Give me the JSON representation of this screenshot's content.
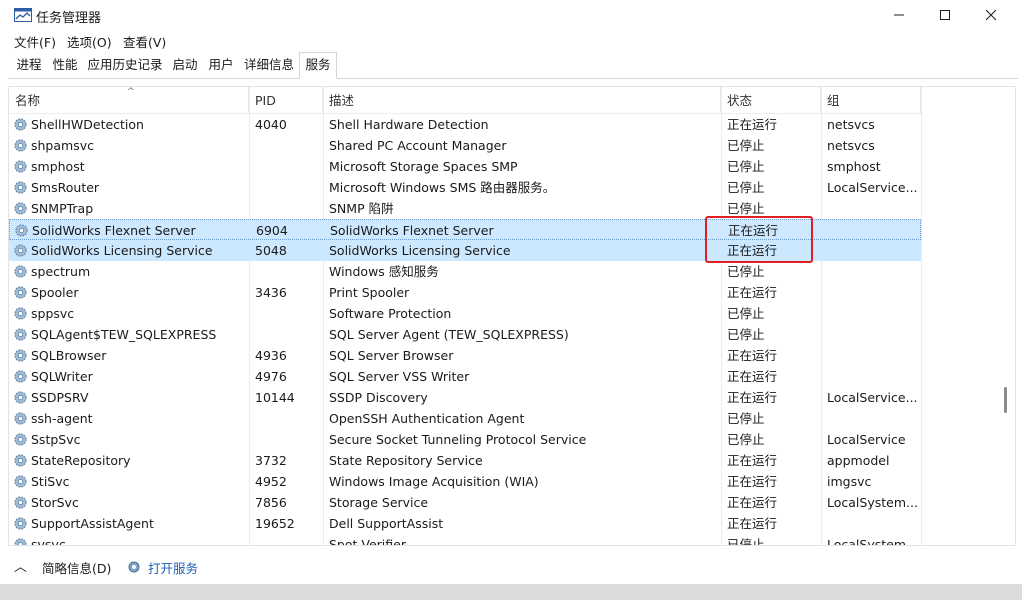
{
  "window": {
    "title": "任务管理器"
  },
  "menu": [
    "文件(F)",
    "选项(O)",
    "查看(V)"
  ],
  "tabs": [
    "进程",
    "性能",
    "应用历史记录",
    "启动",
    "用户",
    "详细信息",
    "服务"
  ],
  "active_tab": "服务",
  "columns": {
    "name": "名称",
    "pid": "PID",
    "desc": "描述",
    "status": "状态",
    "group": "组"
  },
  "rows": [
    {
      "name": "ShellHWDetection",
      "pid": "4040",
      "desc": "Shell Hardware Detection",
      "status": "正在运行",
      "group": "netsvcs"
    },
    {
      "name": "shpamsvc",
      "pid": "",
      "desc": "Shared PC Account Manager",
      "status": "已停止",
      "group": "netsvcs"
    },
    {
      "name": "smphost",
      "pid": "",
      "desc": "Microsoft Storage Spaces SMP",
      "status": "已停止",
      "group": "smphost"
    },
    {
      "name": "SmsRouter",
      "pid": "",
      "desc": "Microsoft Windows SMS 路由器服务。",
      "status": "已停止",
      "group": "LocalService..."
    },
    {
      "name": "SNMPTrap",
      "pid": "",
      "desc": "SNMP 陷阱",
      "status": "已停止",
      "group": ""
    },
    {
      "name": "SolidWorks Flexnet Server",
      "pid": "6904",
      "desc": "SolidWorks Flexnet Server",
      "status": "正在运行",
      "group": ""
    },
    {
      "name": "SolidWorks Licensing Service",
      "pid": "5048",
      "desc": "SolidWorks Licensing Service",
      "status": "正在运行",
      "group": ""
    },
    {
      "name": "spectrum",
      "pid": "",
      "desc": "Windows 感知服务",
      "status": "已停止",
      "group": ""
    },
    {
      "name": "Spooler",
      "pid": "3436",
      "desc": "Print Spooler",
      "status": "正在运行",
      "group": ""
    },
    {
      "name": "sppsvc",
      "pid": "",
      "desc": "Software Protection",
      "status": "已停止",
      "group": ""
    },
    {
      "name": "SQLAgent$TEW_SQLEXPRESS",
      "pid": "",
      "desc": "SQL Server Agent (TEW_SQLEXPRESS)",
      "status": "已停止",
      "group": ""
    },
    {
      "name": "SQLBrowser",
      "pid": "4936",
      "desc": "SQL Server Browser",
      "status": "正在运行",
      "group": ""
    },
    {
      "name": "SQLWriter",
      "pid": "4976",
      "desc": "SQL Server VSS Writer",
      "status": "正在运行",
      "group": ""
    },
    {
      "name": "SSDPSRV",
      "pid": "10144",
      "desc": "SSDP Discovery",
      "status": "正在运行",
      "group": "LocalService..."
    },
    {
      "name": "ssh-agent",
      "pid": "",
      "desc": "OpenSSH Authentication Agent",
      "status": "已停止",
      "group": ""
    },
    {
      "name": "SstpSvc",
      "pid": "",
      "desc": "Secure Socket Tunneling Protocol Service",
      "status": "已停止",
      "group": "LocalService"
    },
    {
      "name": "StateRepository",
      "pid": "3732",
      "desc": "State Repository Service",
      "status": "正在运行",
      "group": "appmodel"
    },
    {
      "name": "StiSvc",
      "pid": "4952",
      "desc": "Windows Image Acquisition (WIA)",
      "status": "正在运行",
      "group": "imgsvc"
    },
    {
      "name": "StorSvc",
      "pid": "7856",
      "desc": "Storage Service",
      "status": "正在运行",
      "group": "LocalSystem..."
    },
    {
      "name": "SupportAssistAgent",
      "pid": "19652",
      "desc": "Dell SupportAssist",
      "status": "正在运行",
      "group": ""
    },
    {
      "name": "svsvc",
      "pid": "",
      "desc": "Spot Verifier",
      "status": "已停止",
      "group": "LocalSystem..."
    }
  ],
  "selected_row": 5,
  "highlighted_row": 6,
  "footer": {
    "less_details": "简略信息(D)",
    "open_services": "打开服务"
  },
  "colors": {
    "selection": "#cde8ff",
    "annotation_box": "#e02020"
  }
}
